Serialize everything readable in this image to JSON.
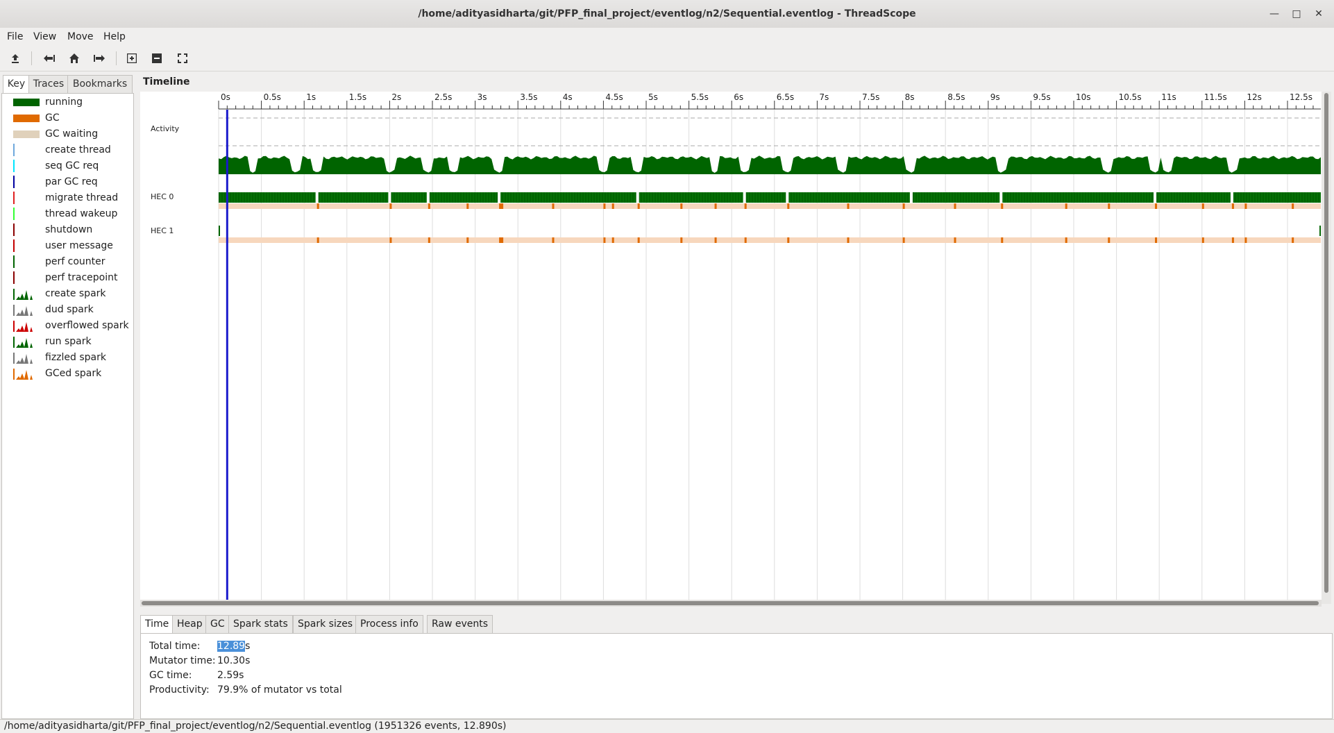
{
  "window": {
    "title": "/home/adityasidharta/git/PFP_final_project/eventlog/n2/Sequential.eventlog - ThreadScope",
    "controls": [
      "minimize",
      "maximize",
      "close"
    ]
  },
  "menu": [
    "File",
    "View",
    "Move",
    "Help"
  ],
  "toolbar": {
    "buttons": [
      {
        "name": "open-icon",
        "glyph": "upload"
      },
      {
        "name": "scroll-left-icon",
        "glyph": "left"
      },
      {
        "name": "home-icon",
        "glyph": "home"
      },
      {
        "name": "scroll-right-icon",
        "glyph": "right"
      },
      {
        "name": "zoom-in-icon",
        "glyph": "plus"
      },
      {
        "name": "zoom-out-icon",
        "glyph": "minus"
      },
      {
        "name": "zoom-fit-icon",
        "glyph": "fit"
      }
    ]
  },
  "side_tabs": [
    "Key",
    "Traces",
    "Bookmarks"
  ],
  "key_items": [
    {
      "label": "running",
      "kind": "bar",
      "color": "#006400"
    },
    {
      "label": "GC",
      "kind": "bar",
      "color": "#e06a00"
    },
    {
      "label": "GC waiting",
      "kind": "bar",
      "color": "#e0d1bb"
    },
    {
      "label": "create thread",
      "kind": "line",
      "color": "#6fa8dc"
    },
    {
      "label": "seq GC req",
      "kind": "line",
      "color": "#00e5ff"
    },
    {
      "label": "par GC req",
      "kind": "line",
      "color": "#0000a0"
    },
    {
      "label": "migrate thread",
      "kind": "line",
      "color": "#e02020"
    },
    {
      "label": "thread wakeup",
      "kind": "line",
      "color": "#33ff33"
    },
    {
      "label": "shutdown",
      "kind": "line",
      "color": "#8b0000"
    },
    {
      "label": "user message",
      "kind": "line",
      "color": "#c40000"
    },
    {
      "label": "perf counter",
      "kind": "line",
      "color": "#006400"
    },
    {
      "label": "perf tracepoint",
      "kind": "line",
      "color": "#8b0000"
    },
    {
      "label": "create spark",
      "kind": "spark",
      "color": "#006400"
    },
    {
      "label": "dud spark",
      "kind": "spark",
      "color": "#777777"
    },
    {
      "label": "overflowed spark",
      "kind": "spark",
      "color": "#cc0000"
    },
    {
      "label": "run spark",
      "kind": "spark",
      "color": "#006400"
    },
    {
      "label": "fizzled spark",
      "kind": "spark",
      "color": "#777777"
    },
    {
      "label": "GCed spark",
      "kind": "spark",
      "color": "#e06a00"
    }
  ],
  "timeline": {
    "label": "Timeline",
    "ticks": [
      "0s",
      "0.5s",
      "1s",
      "1.5s",
      "2s",
      "2.5s",
      "3s",
      "3.5s",
      "4s",
      "4.5s",
      "5s",
      "5.5s",
      "6s",
      "6.5s",
      "7s",
      "7.5s",
      "8s",
      "8.5s",
      "9s",
      "9.5s",
      "10s",
      "10.5s",
      "11s",
      "11.5s",
      "12s",
      "12.5s"
    ],
    "tick_values": [
      0,
      0.5,
      1,
      1.5,
      2,
      2.5,
      3,
      3.5,
      4,
      4.5,
      5,
      5.5,
      6,
      6.5,
      7,
      7.5,
      8,
      8.5,
      9,
      9.5,
      10,
      10.5,
      11,
      11.5,
      12,
      12.5
    ],
    "max_seconds": 12.89,
    "cursor_seconds": 0.1,
    "rows": [
      "Activity",
      "HEC 0",
      "HEC 1"
    ],
    "gc_times": [
      1.15,
      2.0,
      2.45,
      3.28,
      4.5,
      4.9,
      6.15,
      6.65,
      8.0,
      9.15,
      10.4,
      10.95,
      11.85,
      11.5,
      12.0,
      2.9,
      5.8,
      7.35,
      8.6,
      9.9,
      5.4,
      4.6,
      12.55,
      3.9
    ],
    "activity_dips": [
      1.15,
      2.0,
      2.45,
      3.28,
      4.9,
      6.15,
      6.65,
      8.1,
      9.15,
      10.95,
      11.85,
      0.4,
      0.9,
      2.75,
      4.5,
      5.8,
      7.3,
      10.4,
      11.1
    ]
  },
  "colors": {
    "running": "#006400",
    "gc": "#e06a00",
    "gc_waiting_band": "#f7d7bd",
    "cursor": "#1a1acc"
  },
  "bottom_tabs": [
    "Time",
    "Heap",
    "GC",
    "Spark stats",
    "Spark sizes",
    "Process info",
    "Raw events"
  ],
  "stats": {
    "total_time_label": "Total time:",
    "total_time_selected": "12.89",
    "total_time_unit": "s",
    "mutator_time_label": "Mutator time:",
    "mutator_time": "10.30s",
    "gc_time_label": "GC time:",
    "gc_time": "2.59s",
    "productivity_label": "Productivity:",
    "productivity": "79.9% of mutator vs total"
  },
  "status": "/home/adityasidharta/git/PFP_final_project/eventlog/n2/Sequential.eventlog (1951326 events, 12.890s)"
}
